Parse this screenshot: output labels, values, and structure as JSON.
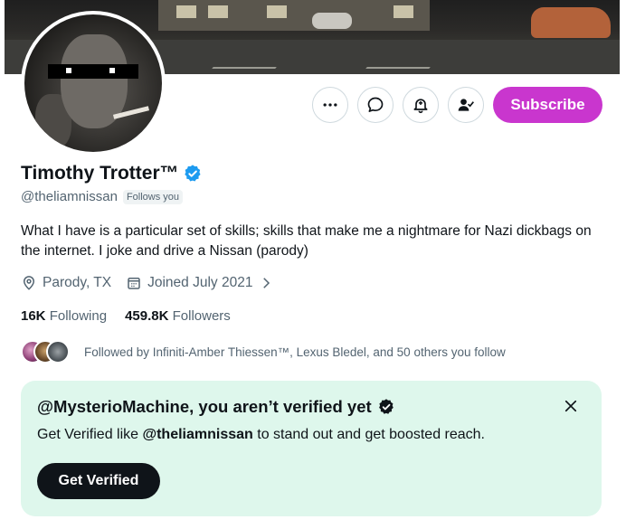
{
  "banner": {
    "alt": ""
  },
  "profile": {
    "display_name": "Timothy Trotter™",
    "handle": "@theliamnissan",
    "follows_you": "Follows you",
    "bio": "What I have is a particular set of skills; skills that make me a nightmare for Nazi dickbags on the internet. I joke and drive a Nissan (parody)",
    "location": "Parody, TX",
    "joined": "Joined July 2021",
    "following_count": "16K",
    "following_label": "Following",
    "followers_count": "459.8K",
    "followers_label": "Followers",
    "followed_by": "Followed by Infiniti-Amber Thiessen™, Lexus Bledel, and 50 others you follow"
  },
  "actions": {
    "more_icon": "more-horizontal-icon",
    "message_icon": "message-icon",
    "notify_icon": "notification-bell-icon",
    "following_icon": "person-check-icon",
    "subscribe_label": "Subscribe"
  },
  "verify_card": {
    "title": "@MysterioMachine, you aren’t verified yet",
    "desc_prefix": "Get Verified like ",
    "desc_handle": "@theliamnissan",
    "desc_suffix": " to stand out and get boosted reach.",
    "button_label": "Get Verified"
  },
  "colors": {
    "accent_subscribe": "#c936ce",
    "verified_blue": "#1d9bf0",
    "card_bg": "#def7ec",
    "text_secondary": "#536471"
  }
}
